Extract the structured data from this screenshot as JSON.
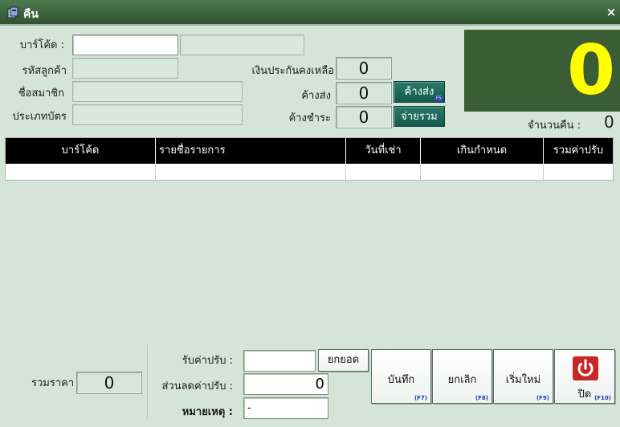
{
  "window": {
    "title": "คืน",
    "close_label": "×"
  },
  "member": {
    "barcode_label": "บาร์โค้ด :",
    "barcode_value": "",
    "customer_code_label": "รหัสลูกค้า",
    "member_name_label": "ชื่อสมาชิก",
    "card_type_label": "ประเภทบัตร"
  },
  "balances": {
    "deposit_remaining_label": "เงินประกันคงเหลือ",
    "deposit_remaining_value": "0",
    "outstanding_return_label": "ค้างส่ง",
    "outstanding_return_value": "0",
    "outstanding_payment_label": "ค้างชำระ",
    "outstanding_payment_value": "0",
    "outstanding_button_label": "ค้างส่ง",
    "outstanding_button_key": "F5",
    "pay_all_button_label": "จ่ายรวม"
  },
  "display": {
    "big_counter": "0",
    "return_count_label": "จำนวนคืน :",
    "return_count_value": "0"
  },
  "table": {
    "columns": [
      "บาร์โค้ด",
      "รายชื่อรายการ",
      "วันที่เช่า",
      "เกินกำหนด",
      "รวมค่าปรับ"
    ]
  },
  "footer": {
    "total_price_label": "รวมราคา",
    "total_price_value": "0",
    "receive_fine_label": "รับค่าปรับ :",
    "receive_fine_value": "",
    "carry_button_label": "ยกยอด",
    "fine_discount_label": "ส่วนลดค่าปรับ :",
    "fine_discount_value": "0",
    "note_label": "หมายเหตุ :",
    "note_value": "-"
  },
  "actions": {
    "save": {
      "label": "บันทึก",
      "key": "(F7)"
    },
    "cancel": {
      "label": "ยกเลิก",
      "key": "(F8)"
    },
    "restart": {
      "label": "เริ่มใหม่",
      "key": "(F9)"
    },
    "close": {
      "label": "ปิด",
      "key": "(F10)"
    }
  },
  "colors": {
    "titlebar": "#3b633d",
    "background": "#d4e4d8",
    "display_bg": "#3b5d36",
    "display_digit": "#ffff00",
    "teal_button": "#115a4c",
    "power_icon": "#c62828"
  },
  "icons": {
    "title": "app-icon",
    "power": "power-icon"
  }
}
